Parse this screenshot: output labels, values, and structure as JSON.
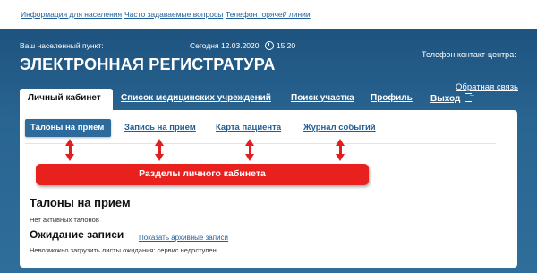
{
  "top_links": [
    "Информация для населения",
    "Часто задаваемые вопросы",
    "Телефон горячей линии"
  ],
  "header": {
    "locality_label": "Ваш населенный пункт:",
    "date_text": "Сегодня 12.03.2020",
    "time_text": "15:20",
    "title": "ЭЛЕКТРОННАЯ РЕГИСТРАТУРА",
    "phone_label": "Телефон контакт-центра:",
    "feedback_link": "Обратная связь"
  },
  "nav_tabs": [
    "Личный кабинет",
    "Список медицинских учреждений",
    "Поиск участка",
    "Профиль",
    "Выход"
  ],
  "sub_tabs": [
    "Талоны на прием",
    "Запись на прием",
    "Карта пациента",
    "Журнал событий"
  ],
  "annotation": {
    "callout_text": "Разделы личного кабинета",
    "color": "#e8211f"
  },
  "content": {
    "tickets_title": "Талоны на прием",
    "tickets_empty": "Нет активных талонов",
    "waiting_title": "Ожидание записи",
    "archive_link": "Показать архивные записи",
    "waiting_error": "Невозможно загрузить листы ожидания: сервис недоступен."
  },
  "colors": {
    "header_bg": "#2a6592",
    "link": "#1f5f99",
    "active_subtab": "#2d6b9c"
  }
}
